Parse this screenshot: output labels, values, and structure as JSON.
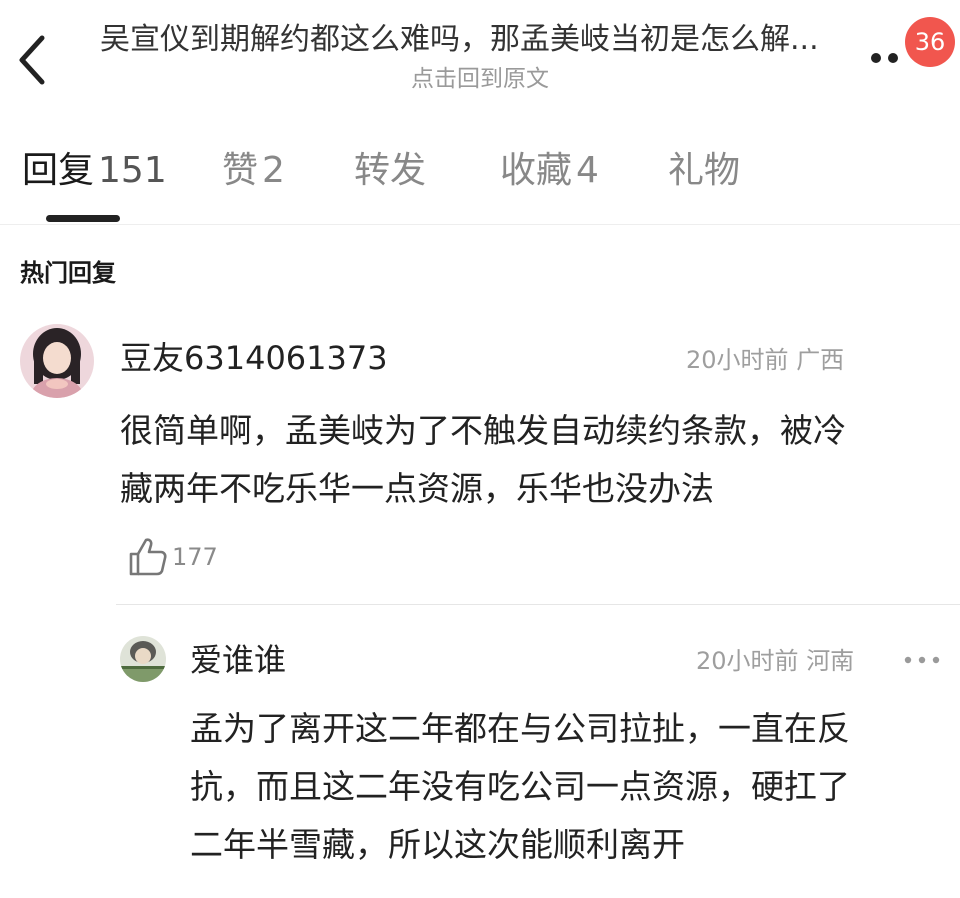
{
  "header": {
    "back_icon": "chevron-left-icon",
    "title": "吴宣仪到期解约都这么难吗，那孟美岐当初是怎么解...",
    "subtitle": "点击回到原文",
    "more_icon": "more-icon",
    "badge_count": "36",
    "badge_color": "#f1564e"
  },
  "tabs": [
    {
      "label": "回复",
      "count": "151",
      "active": true
    },
    {
      "label": "赞",
      "count": "2",
      "active": false
    },
    {
      "label": "转发",
      "count": "",
      "active": false
    },
    {
      "label": "收藏",
      "count": "4",
      "active": false
    },
    {
      "label": "礼物",
      "count": "",
      "active": false
    }
  ],
  "section": {
    "title": "热门回复"
  },
  "comments": [
    {
      "username": "豆友6314061373",
      "time": "20小时前",
      "location": "广西",
      "text_lines": [
        "很简单啊，孟美岐为了不触发自动续约条款，被冷",
        "藏两年不吃乐华一点资源，乐华也没办法"
      ],
      "like_icon": "thumbs-up-icon",
      "likes": "177"
    },
    {
      "username": "爱谁谁",
      "time": "20小时前",
      "location": "河南",
      "more_icon": "more-horizontal-icon",
      "text_lines": [
        "孟为了离开这二年都在与公司拉扯，一直在反",
        "抗，而且这二年没有吃公司一点资源，硬扛了",
        "二年半雪藏，所以这次能顺利离开"
      ]
    }
  ]
}
